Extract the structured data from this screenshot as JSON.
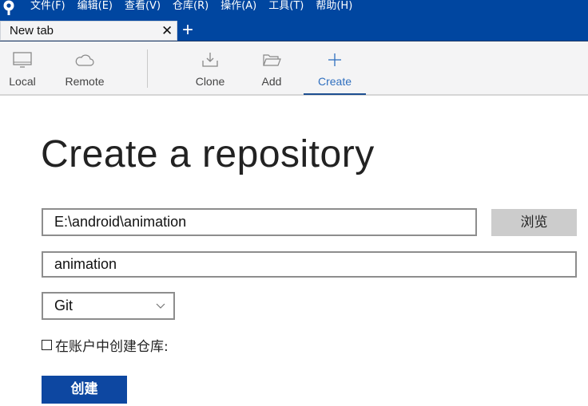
{
  "menubar": {
    "items": [
      "文件(F)",
      "编辑(E)",
      "查看(V)",
      "仓库(R)",
      "操作(A)",
      "工具(T)",
      "帮助(H)"
    ]
  },
  "tabs": {
    "active_label": "New tab",
    "close_glyph": "✕",
    "new_tab_glyph": "+"
  },
  "toolbar": {
    "items": [
      {
        "label": "Local",
        "icon": "monitor-icon"
      },
      {
        "label": "Remote",
        "icon": "cloud-icon"
      },
      {
        "label": "Clone",
        "icon": "download-icon"
      },
      {
        "label": "Add",
        "icon": "folder-icon"
      },
      {
        "label": "Create",
        "icon": "plus-icon",
        "active": true
      }
    ]
  },
  "main": {
    "title": "Create a repository",
    "path_value": "E:\\android\\animation",
    "browse_label": "浏览",
    "name_value": "animation",
    "vcs_type": "Git",
    "checkbox_label": "在账户中创建仓库:",
    "checkbox_checked": false,
    "create_label": "创建"
  },
  "colors": {
    "brand": "#0046a0",
    "accent": "#2f6fbf",
    "create_button": "#0d47a1"
  }
}
